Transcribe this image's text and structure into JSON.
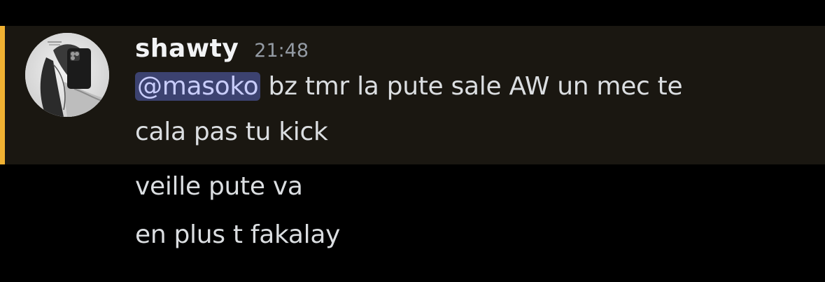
{
  "message": {
    "author": "shawty",
    "timestamp": "21:48",
    "mention": "@masoko",
    "first_line_rest": " bz tmr la pute sale AW un mec te",
    "second_line": "cala pas tu kick"
  },
  "followups": [
    "veille pute va",
    "en plus t fakalay"
  ],
  "colors": {
    "background": "#000000",
    "highlight_background": "#1a1711",
    "mention_bar": "#f0b132",
    "mention_pill": "#3c4270",
    "mention_text": "#c9cdfb",
    "username": "#f2f3f5",
    "timestamp": "#949ba4",
    "text": "#dbdee1"
  },
  "icons": {
    "avatar": "avatar-photo"
  }
}
